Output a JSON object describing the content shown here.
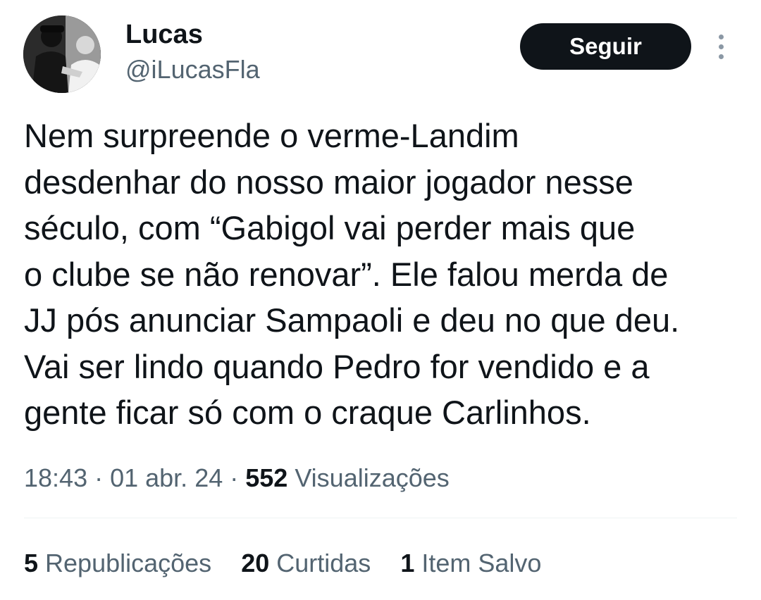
{
  "author": {
    "name": "Lucas",
    "handle": "@iLucasFla"
  },
  "follow_button": {
    "label": "Seguir"
  },
  "more_icon": "more-vertical-icon",
  "tweet": {
    "lines": [
      "Nem surpreende o verme-Landim",
      "desdenhar do nosso maior jogador nesse",
      "século, com “Gabigol vai perder mais que",
      "o clube se não renovar”. Ele falou merda de",
      "JJ pós anunciar Sampaoli e deu no que deu.",
      "Vai ser lindo quando Pedro for vendido e a",
      "gente ficar só com o craque Carlinhos."
    ]
  },
  "meta": {
    "time": "18:43",
    "separator": " · ",
    "date": "01 abr. 24",
    "views_count": "552",
    "views_label": " Visualizações"
  },
  "stats": [
    {
      "count": "5",
      "label": " Republicações"
    },
    {
      "count": "20",
      "label": " Curtidas"
    },
    {
      "count": "1",
      "label": " Item Salvo"
    }
  ],
  "colors": {
    "text": "#0f1419",
    "secondary": "#536471",
    "button_bg": "#0f1419",
    "button_text": "#ffffff",
    "divider": "#eff3f4"
  }
}
